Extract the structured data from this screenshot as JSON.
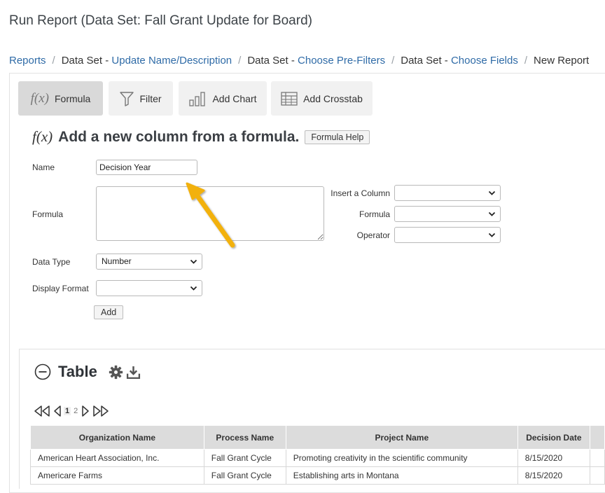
{
  "page": {
    "title": "Run Report (Data Set: Fall Grant Update for Board)"
  },
  "breadcrumb": {
    "reports": "Reports",
    "ds1_prefix": "Data Set - ",
    "ds1_link": "Update Name/Description",
    "ds2_prefix": "Data Set - ",
    "ds2_link": "Choose Pre-Filters",
    "ds3_prefix": "Data Set - ",
    "ds3_link": "Choose Fields",
    "current": "New Report"
  },
  "toolbar": {
    "formula_icon": "f(x)",
    "formula_label": "Formula",
    "filter_label": "Filter",
    "add_chart_label": "Add Chart",
    "add_crosstab_label": "Add Crosstab"
  },
  "formula_section": {
    "icon": "f(x)",
    "heading": "Add a new column from a formula.",
    "help_button": "Formula Help",
    "name_label": "Name",
    "name_value": "Decision Year",
    "formula_label": "Formula",
    "formula_value": "",
    "insert_column_label": "Insert a Column",
    "insert_column_value": "",
    "formula_select_label": "Formula",
    "formula_select_value": "",
    "operator_label": "Operator",
    "operator_value": "",
    "data_type_label": "Data Type",
    "data_type_value": "Number",
    "display_format_label": "Display Format",
    "display_format_value": "",
    "add_button": "Add"
  },
  "table_section": {
    "title": "Table",
    "pager": {
      "current_page": "1",
      "other_page": "2"
    },
    "columns": [
      "Organization Name",
      "Process Name",
      "Project Name",
      "Decision Date"
    ],
    "rows": [
      [
        "American Heart Association, Inc.",
        "Fall Grant Cycle",
        "Promoting creativity in the scientific community",
        "8/15/2020"
      ],
      [
        "Americare Farms",
        "Fall Grant Cycle",
        "Establishing arts in Montana",
        "8/15/2020"
      ]
    ]
  },
  "colors": {
    "link": "#2f6ba7",
    "annotation_arrow": "#f2b10d"
  }
}
